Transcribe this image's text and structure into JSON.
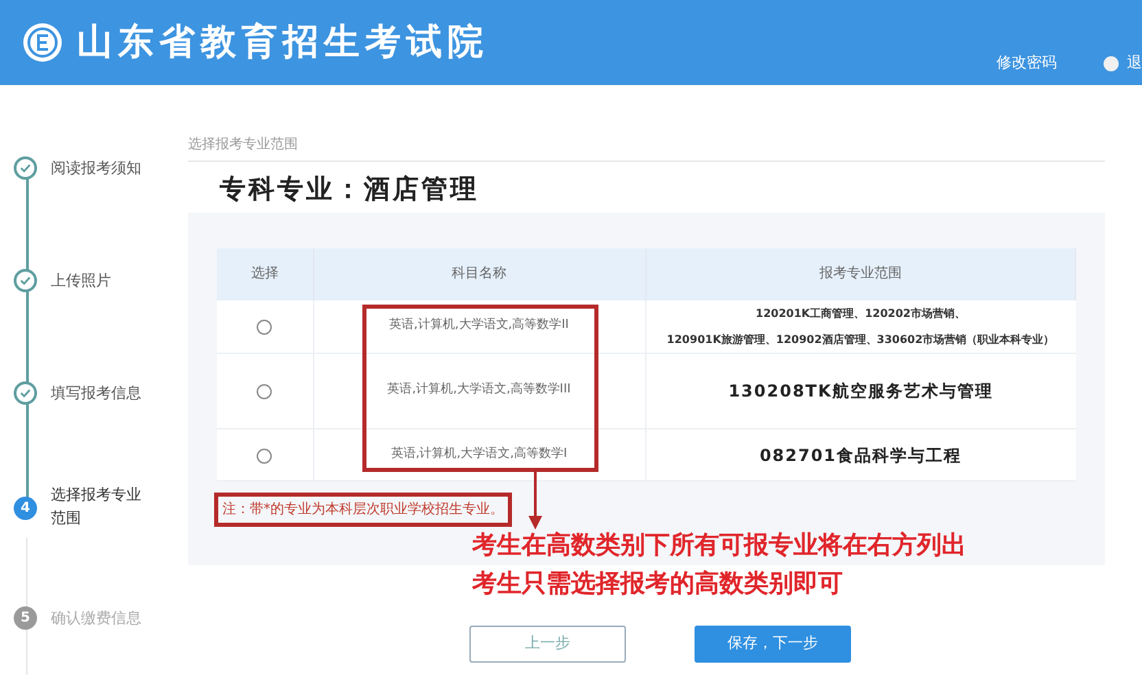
{
  "header": {
    "site_title": "山东省教育招生考试院",
    "links": [
      {
        "label": "修改密码",
        "kind": "text"
      },
      {
        "label": "退",
        "kind": "user"
      }
    ]
  },
  "steps": [
    {
      "label": "阅读报考须知",
      "done": true,
      "current": false
    },
    {
      "label": "上传照片",
      "done": true,
      "current": false
    },
    {
      "label": "填写报考信息",
      "done": true,
      "current": false
    },
    {
      "number": "4",
      "label": "选择报考专业范围",
      "done": false,
      "current": true
    },
    {
      "number": "5",
      "label": "确认缴费信息",
      "done": false,
      "current": false
    }
  ],
  "breadcrumb": "选择报考专业范围",
  "heading": "专科专业：酒店管理",
  "table": {
    "columns": [
      "选择",
      "科目名称",
      "报考专业范围"
    ],
    "rows": [
      {
        "selected": false,
        "subjects": "英语,计算机,大学语文,高等数学II",
        "range": [
          "120201K工商管理、120202市场营销、",
          "120901K旅游管理、120902酒店管理、330602市场营销（职业本科专业）"
        ],
        "emphasis": false
      },
      {
        "selected": false,
        "subjects": "英语,计算机,大学语文,高等数学III",
        "range": [
          "130208TK航空服务艺术与管理"
        ],
        "emphasis": true
      },
      {
        "selected": false,
        "subjects": "英语,计算机,大学语文,高等数学I",
        "range": [
          "082701食品科学与工程"
        ],
        "emphasis": true
      }
    ]
  },
  "note": "注：带*的专业为本科层次职业学校招生专业。",
  "annotation": {
    "lines": [
      "考生在高数类别下所有可报专业将在右方列出",
      "考生只需选择报考的高数类别即可"
    ]
  },
  "buttons": [
    {
      "label": "上一步",
      "kind": "secondary"
    },
    {
      "label": "保存，下一步",
      "kind": "primary"
    }
  ]
}
